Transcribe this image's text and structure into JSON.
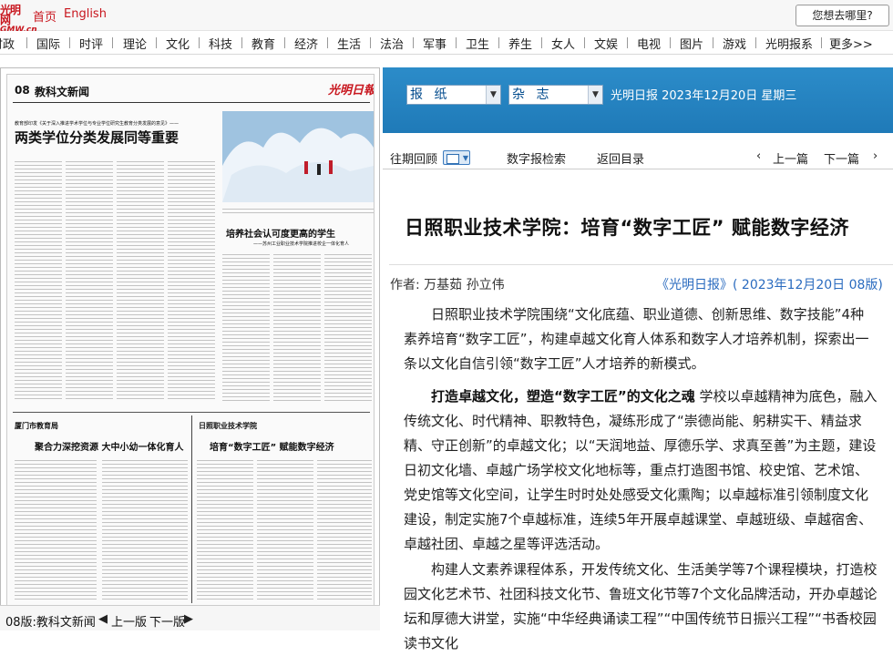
{
  "top": {
    "logo_line1": "光明网",
    "logo_line2": "GMW.cn",
    "links": [
      "首页",
      "English"
    ],
    "search_button": "您想去哪里?"
  },
  "nav": [
    "时政",
    "国际",
    "时评",
    "理论",
    "文化",
    "科技",
    "教育",
    "经济",
    "生活",
    "法治",
    "军事",
    "卫生",
    "养生",
    "女人",
    "文娱",
    "电视",
    "图片",
    "游戏",
    "光明报系",
    "更多>>"
  ],
  "paper_thumb": {
    "page_label": "08",
    "page_name": "教科文新闻",
    "masthead": "光明日報",
    "intro": "教育部印发《关于深入推进学术学位与专业学位研究生教育分类发展的意见》——",
    "headline1": "两类学位分类发展同等重要",
    "headline2": "培养社会认可度更高的学生",
    "subhead2": "——苏州工业职业技术学院推进校企一体化育人",
    "section3": "厦门市教育局",
    "headline3": "聚合力深挖资源  大中小幼一体化育人",
    "section4": "日照职业技术学院",
    "headline4": "培育“数字工匠”  赋能数字经济"
  },
  "pagebar": {
    "current": "08版:教科文新闻",
    "prev": "上一版",
    "next": "下一版"
  },
  "datebar": {
    "select1": "报 纸",
    "select2": "杂 志",
    "date_text": "光明日报  2023年12月20日  星期三"
  },
  "toolbar": {
    "back": "往期回顾",
    "search": "数字报检索",
    "toc": "返回目录",
    "prev": "上一篇",
    "next": "下一篇"
  },
  "article": {
    "title": "日照职业技术学院：培育“数字工匠”  赋能数字经济",
    "byline": "作者: 万基茹  孙立伟",
    "source": "《光明日报》(  2023年12月20日  08版)",
    "para1": "日照职业技术学院围绕“文化底蕴、职业道德、创新思维、数字技能”4种素养培育“数字工匠”，构建卓越文化育人体系和数字人才培养机制，探索出一条以文化自信引领“数字工匠”人才培养的新模式。",
    "para2_bold": "打造卓越文化，塑造“数字工匠”的文化之魂",
    "para2": "  学校以卓越精神为底色，融入传统文化、时代精神、职教特色，凝练形成了“崇德尚能、躬耕实干、精益求精、守正创新”的卓越文化；以“天润地益、厚德乐学、求真至善”为主题，建设日初文化墙、卓越广场学校文化地标等，重点打造图书馆、校史馆、艺术馆、党史馆等文化空间，让学生时时处处感受文化熏陶；以卓越标准引领制度文化建设，制定实施7个卓越标准，连续5年开展卓越课堂、卓越班级、卓越宿舍、卓越社团、卓越之星等评选活动。",
    "para3": "构建人文素养课程体系，开发传统文化、生活美学等7个课程模块，打造校园文化艺术节、社团科技文化节、鲁班文化节等7个文化品牌活动，开办卓越论坛和厚德大讲堂，实施“中华经典诵读工程”“中国传统节日振兴工程”“书香校园读书文化"
  }
}
